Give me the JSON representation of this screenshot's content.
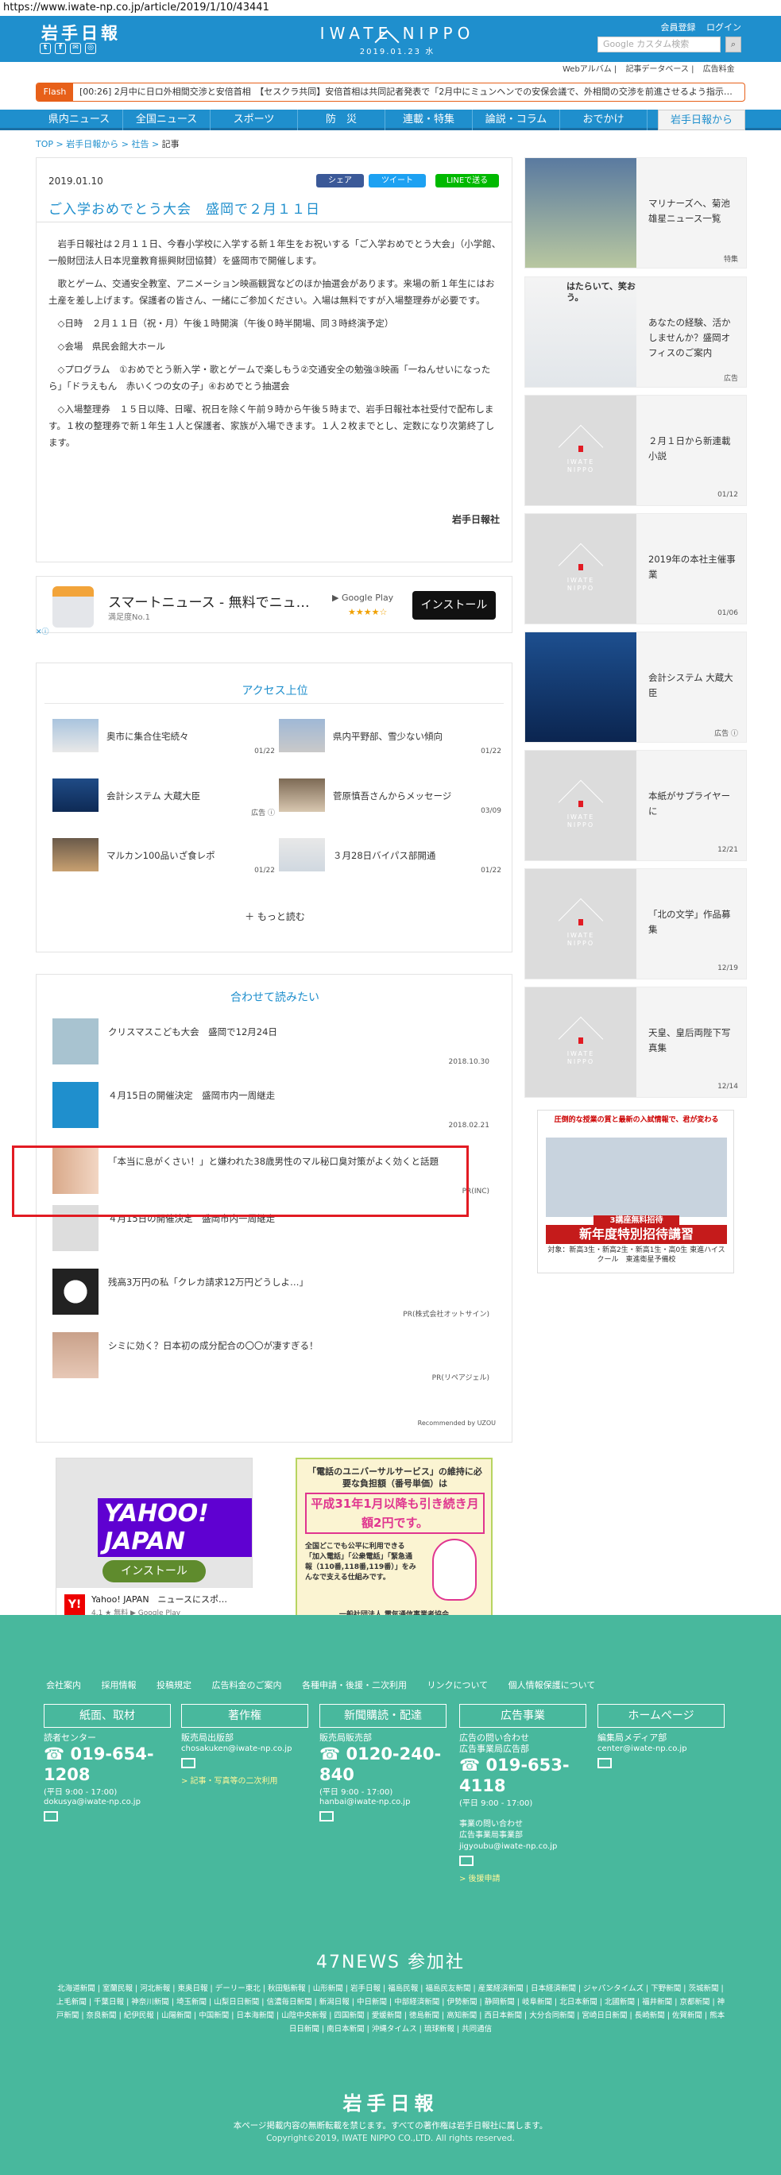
{
  "url": "https://www.iwate-np.co.jp/article/2019/1/10/43441",
  "header": {
    "logo": "岩手日報",
    "brand": "IWATE NIPPO",
    "date": "2019.01.23 水",
    "member_link": "会員登録",
    "login_link": "ログイン",
    "search_placeholder": "Google カスタム検索",
    "search_icon": "search-icon",
    "social": [
      "twitter-icon",
      "facebook-icon",
      "mail-icon",
      "instagram-icon"
    ]
  },
  "toplinks": [
    "Webアルバム",
    "記事データベース",
    "広告料金"
  ],
  "flash": {
    "label": "Flash",
    "text": "[00:26]  2月中に日ロ外相間交渉と安倍首相　【セスクラ共同】安倍首相は共同記者発表で「2月中にミュンヘンでの安保会議で、外相間の交渉を前進させるよう指示…"
  },
  "nav": [
    "県内ニュース",
    "全国ニュース",
    "スポーツ",
    "防　災",
    "連載・特集",
    "論説・コラム",
    "おでかけ",
    "岩手日報から"
  ],
  "crumb": {
    "top": "TOP",
    "c1": "岩手日報から",
    "c2": "社告",
    "cur": "記事"
  },
  "article": {
    "date": "2019.01.10",
    "share": [
      "シェア",
      "ツイート",
      "LINEで送る"
    ],
    "title": "ご入学おめでとう大会　盛岡で２月１１日",
    "p1": "岩手日報社は２月１１日、今春小学校に入学する新１年生をお祝いする「ご入学おめでとう大会」（小学館、一般財団法人日本児童教育振興財団協賛）を盛岡市で開催します。",
    "p2": "歌とゲーム、交通安全教室、アニメーション映画観賞などのほか抽選会があります。来場の新１年生にはお土産を差し上げます。保護者の皆さん、一緒にご参加ください。入場は無料ですが入場整理券が必要です。",
    "p3": "◇日時　２月１１日（祝・月）午後１時開演（午後０時半開場、同３時終演予定）",
    "p4": "◇会場　県民会館大ホール",
    "p5": "◇プログラム　①おめでとう新入学・歌とゲームで楽しもう②交通安全の勉強③映画「一ねんせいになったら」「ドラえもん　赤いくつの女の子」④おめでとう抽選会",
    "p6": "◇入場整理券　１５日以降、日曜、祝日を除く午前９時から午後５時まで、岩手日報社本社受付で配布します。１枚の整理券で新１年生１人と保護者、家族が入場できます。１人２枚までとし、定数になり次第終了します。",
    "credit": "岩手日報社"
  },
  "ad": {
    "title": "スマートニュース - 無料でニュ…",
    "sub": "満足度No.1",
    "store": "Google Play",
    "stars": "★★★★☆",
    "button": "インストール",
    "mark": "✕ⓘ"
  },
  "ranking": {
    "title": "アクセス上位",
    "items": [
      {
        "t": "奥市に集合住宅続々",
        "d": "01/22"
      },
      {
        "t": "県内平野部、雪少ない傾向",
        "d": "01/22"
      },
      {
        "t": "会計システム 大蔵大臣",
        "d": "広告 ⓘ"
      },
      {
        "t": "菅原慎吾さんからメッセージ",
        "d": "03/09"
      },
      {
        "t": "マルカン100品いざ食レポ",
        "d": "01/22"
      },
      {
        "t": "３月28日バイパス部開通",
        "d": "01/22"
      }
    ],
    "more": "＋ もっと読む"
  },
  "related": {
    "title": "合わせて読みたい",
    "items": [
      {
        "t": "クリスマスこども大会　盛岡で12月24日",
        "d": "2018.10.30"
      },
      {
        "t": "４月15日の開催決定　盛岡市内一周継走",
        "d": "2018.02.21"
      },
      {
        "t": "「本当に息がくさい！」と嫌われた38歳男性のマル秘口臭対策がよく効くと話題",
        "d": "PR(INC)"
      },
      {
        "t": "４月15日の開催決定　盛岡市内一周継走",
        "d": ""
      },
      {
        "t": "残高3万円の私「クレカ請求12万円どうしよ…」",
        "d": "PR(株式会社オットサイン)"
      },
      {
        "t": "シミに効く？日本初の成分配合の〇〇が凄すぎる！",
        "d": "PR(リペアジェル)"
      }
    ],
    "reco": "Recommended by UZOU"
  },
  "yahoo_ad": {
    "logo": "YAHOO! JAPAN",
    "button": "インストール",
    "name": "Yahoo! JAPAN　ニュースにスポ…",
    "rating": "4.1 ★ 無料 ▶ Google Play"
  },
  "uni_ad": {
    "l1": "「電話のユニバーサルサービス」の維持に必要な負担額（番号単価）は",
    "l2": "平成31年1月以降も引き続き月額2円です。",
    "l3": "全国どこでも公平に利用できる「加入電話」「公衆電話」「緊急通報（110番,118番,119番）」をみんなで支える仕組みです。",
    "l4": "一般社団法人 電気通信事業者協会"
  },
  "sidebar": [
    {
      "t": "マリナーズへ、菊池雄星ニュース一覧",
      "d": "特集"
    },
    {
      "t": "あなたの経験、活かしませんか？盛岡オフィスのご案内",
      "d": "広告"
    },
    {
      "t": "２月１日から新連載小説",
      "d": "01/12"
    },
    {
      "t": "2019年の本社主催事業",
      "d": "01/06"
    },
    {
      "t": "会計システム 大蔵大臣",
      "d": "広告 ⓘ"
    },
    {
      "t": "本紙がサプライヤーに",
      "d": "12/21"
    },
    {
      "t": "「北の文学」作品募集",
      "d": "12/19"
    },
    {
      "t": "天皇、皇后両陛下写真集",
      "d": "12/14"
    }
  ],
  "side_ad_copy": "はたらいて、笑おう。",
  "taiko": {
    "top": "圧倒的な授業の質と最新の入試情報で、君が変わる",
    "big": "新年度特別招待講習",
    "sm": "対象：新高3生・新高2生・新高1生・高0生\n東進ハイスクール　東進衛星予備校",
    "badge": "3講座無料招待"
  },
  "footer": {
    "links": [
      "会社案内",
      "採用情報",
      "投稿規定",
      "広告料金のご案内",
      "各種申請・後援・二次利用",
      "リンクについて",
      "個人情報保護について"
    ],
    "cols": [
      {
        "box": "紙面、取材",
        "l": "読者センター",
        "ph": "019-654-1208",
        "hr": "(平日 9:00 - 17:00)",
        "ml": "dokusya@iwate-np.co.jp",
        "yl": ""
      },
      {
        "box": "著作権",
        "l": "販売局出版部",
        "ph": "",
        "hr": "",
        "ml": "chosakuken@iwate-np.co.jp",
        "yl": "> 記事・写真等の二次利用"
      },
      {
        "box": "新聞購読・配達",
        "l": "販売局販売部",
        "ph": "0120-240-840",
        "hr": "(平日 9:00 - 17:00)",
        "ml": "hanbai@iwate-np.co.jp",
        "yl": ""
      },
      {
        "box": "広告事業",
        "l": "広告の問い合わせ\n広告事業局広告部",
        "ph": "019-653-4118",
        "hr": "(平日 9:00 - 17:00)",
        "ml": "事業の問い合わせ\n広告事業局事業部\njigyoubu@iwate-np.co.jp",
        "yl": "> 後援申請"
      },
      {
        "box": "ホームページ",
        "l": "編集局メディア部",
        "ph": "",
        "hr": "",
        "ml": "center@iwate-np.co.jp",
        "yl": ""
      }
    ],
    "n47": "47NEWS 参加社",
    "papers": "北海道新聞 | 室蘭民報 | 河北新報 | 東奥日報 | デーリー東北 | 秋田魁新報 | 山形新聞 | 岩手日報 | 福島民報 | 福島民友新聞 | 産業経済新聞 | 日本経済新聞 | ジャパンタイムズ | 下野新聞 | 茨城新聞 | 上毛新聞 | 千葉日報 | 神奈川新聞 | 埼玉新聞 | 山梨日日新聞 | 信濃毎日新聞 | 新潟日報 | 中日新聞 | 中部経済新聞 | 伊勢新聞 | 静岡新聞 | 岐阜新聞 | 北日本新聞 | 北國新聞 | 福井新聞 | 京都新聞 | 神戸新聞 | 奈良新聞 | 紀伊民報 | 山陽新聞 | 中国新聞 | 日本海新聞 | 山陰中央新報 | 四国新聞 | 愛媛新聞 | 徳島新聞 | 高知新聞 | 西日本新聞 | 大分合同新聞 | 宮崎日日新聞 | 長崎新聞 | 佐賀新聞 | 熊本日日新聞 | 南日本新聞 | 沖縄タイムス | 琉球新報 | 共同通信",
    "logo": "岩手日報",
    "note": "本ページ掲載内容の無断転載を禁じます。すべての著作権は岩手日報社に属します。",
    "copy": "Copyright©2019, IWATE NIPPO CO.,LTD. All rights reserved."
  }
}
